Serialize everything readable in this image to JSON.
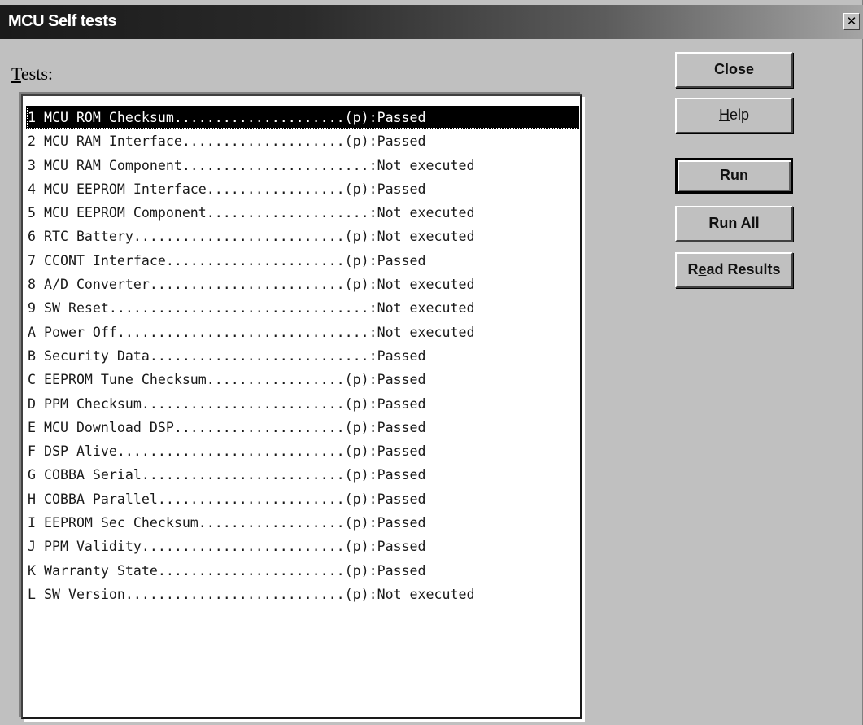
{
  "window": {
    "title": "MCU Self tests",
    "close_glyph": "✕"
  },
  "tests_label": {
    "before": "",
    "underlined": "T",
    "after": "ests:"
  },
  "tests": [
    "1 MCU ROM Checksum.....................(p):Passed",
    "2 MCU RAM Interface....................(p):Passed",
    "3 MCU RAM Component.......................:Not executed",
    "4 MCU EEPROM Interface.................(p):Passed",
    "5 MCU EEPROM Component....................:Not executed",
    "6 RTC Battery..........................(p):Not executed",
    "7 CCONT Interface......................(p):Passed",
    "8 A/D Converter........................(p):Not executed",
    "9 SW Reset................................:Not executed",
    "A Power Off...............................:Not executed",
    "B Security Data...........................:Passed",
    "C EEPROM Tune Checksum.................(p):Passed",
    "D PPM Checksum.........................(p):Passed",
    "E MCU Download DSP.....................(p):Passed",
    "F DSP Alive............................(p):Passed",
    "G COBBA Serial.........................(p):Passed",
    "H COBBA Parallel.......................(p):Passed",
    "I EEPROM Sec Checksum..................(p):Passed",
    "J PPM Validity.........................(p):Passed",
    "K Warranty State.......................(p):Passed",
    "L SW Version...........................(p):Not executed"
  ],
  "selected_index": 0,
  "buttons": {
    "close": {
      "before": "Close",
      "underlined": "",
      "after": ""
    },
    "help": {
      "before": "",
      "underlined": "H",
      "after": "elp"
    },
    "run": {
      "before": "",
      "underlined": "R",
      "after": "un"
    },
    "run_all": {
      "before": "Run ",
      "underlined": "A",
      "after": "ll"
    },
    "read_results": {
      "before": "R",
      "underlined": "e",
      "after": "ad Results"
    }
  }
}
